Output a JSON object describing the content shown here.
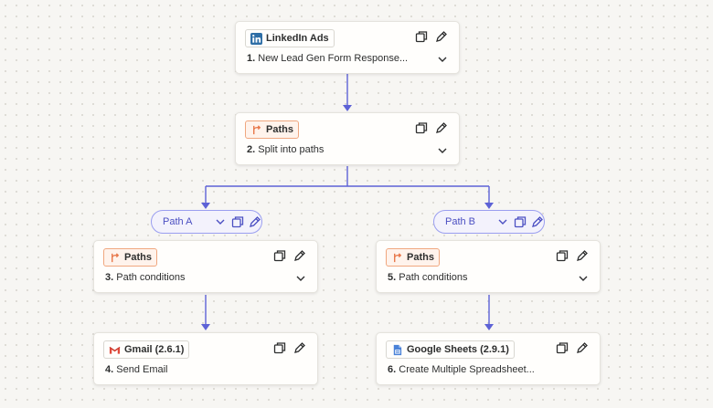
{
  "colors": {
    "connector": "#5d62d6",
    "paths_accent": "#e8774a",
    "linkedin_blue": "#2e6ea6",
    "sheets_blue": "#4a82d8",
    "gmail_red": "#e0493a"
  },
  "steps": [
    {
      "app": "LinkedIn Ads",
      "icon": "linkedin-logo-icon",
      "number": "1.",
      "title": "New Lead Gen Form Response..."
    },
    {
      "app": "Paths",
      "icon": "paths-icon",
      "number": "2.",
      "title": "Split into paths"
    },
    {
      "app": "Paths",
      "icon": "paths-icon",
      "number": "3.",
      "title": "Path conditions"
    },
    {
      "app": "Paths",
      "icon": "paths-icon",
      "number": "5.",
      "title": "Path conditions"
    },
    {
      "app": "Gmail (2.6.1)",
      "icon": "gmail-logo-icon",
      "number": "4.",
      "title": "Send Email"
    },
    {
      "app": "Google Sheets (2.9.1)",
      "icon": "google-sheets-logo-icon",
      "number": "6.",
      "title": "Create Multiple Spreadsheet..."
    }
  ],
  "paths": [
    {
      "label": "Path A"
    },
    {
      "label": "Path B"
    }
  ]
}
